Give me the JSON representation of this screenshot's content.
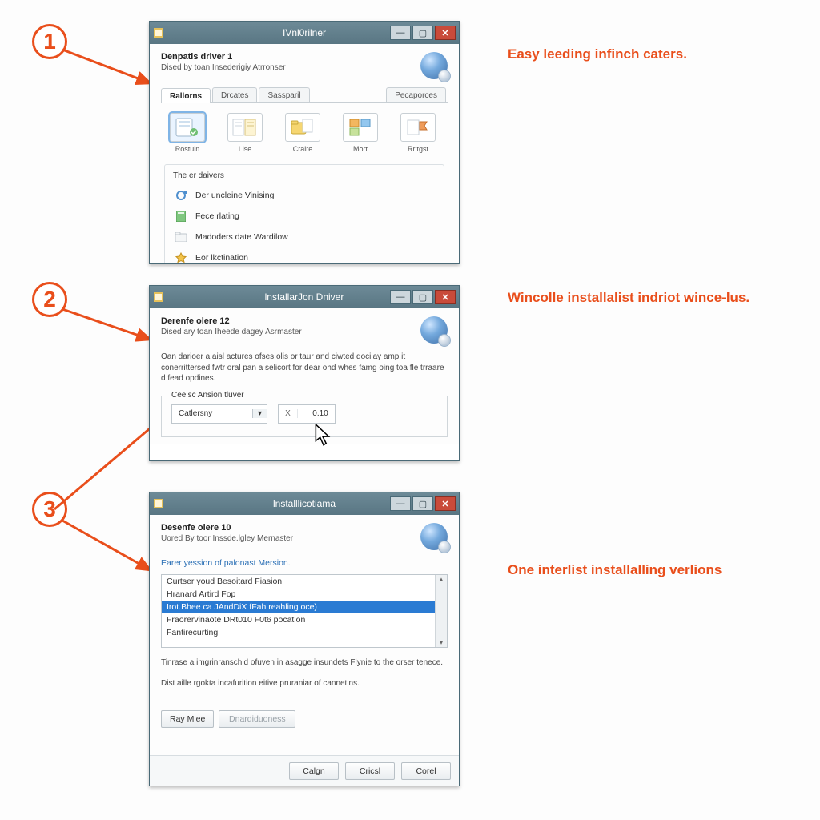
{
  "accent": "#e94e1b",
  "steps": {
    "s1": {
      "num": "1",
      "caption": "Easy leeding infinch caters."
    },
    "s2": {
      "num": "2",
      "caption": "Wincolle installalist indriot wince-lus."
    },
    "s3": {
      "num": "3",
      "caption": "One interlist installalling verlions"
    }
  },
  "win1": {
    "title": "IVnl0rilner",
    "wiz_title": "Denpatis driver 1",
    "wiz_sub": "Dised by toan Insederigiy Atrronser",
    "tabs": {
      "t1": "Rallorns",
      "t2": "Drcates",
      "t3": "Sassparil",
      "right": "Pecaporces"
    },
    "tools": {
      "a": "Rostuin",
      "b": "Lise",
      "c": "Cralre",
      "d": "Mort",
      "e": "Rritgst"
    },
    "group_title": "The er daivers",
    "items": {
      "i1": "Der uncleine Vinising",
      "i2": "Fece rlating",
      "i3": "Madoders date Wardilow",
      "i4": "Eor lkctination"
    }
  },
  "win2": {
    "title": "lnstallarJon Dniver",
    "wiz_title": "Derenfe olere 12",
    "wiz_sub": "Dised ary toan Iheede dagey Asrmaster",
    "body": "Oan darioer a aisl actures ofses olis or taur and ciwted docilay amp it conerrittersed fwtr oral pan a selicort for dear ohd whes famg oing toa fle trraare d fead opdines.",
    "legend": "Ceelsc Ansion tluver",
    "combo_value": "Catlersny",
    "num_label": "X",
    "num_value": "0.10"
  },
  "win3": {
    "title": "lnstalllicotiama",
    "wiz_title": "Desenfe olere 10",
    "wiz_sub": "Uored By toor Inssde.lgley Mernaster",
    "link": "Earer yession of palonast Mersion.",
    "options": {
      "o1": "Curtser youd Besoitard Fiasion",
      "o2": "Hranard Artird Fop",
      "o3": "Irot.Bhee ca JAndDiX fFah reahling oce)",
      "o4": "Fraorervinaote DRt010 F0t6 pocation",
      "o5": "Fantirecurting"
    },
    "note1": "Tinrase a imgrinranschld ofuven in asagge insundets Flynie to the orser tenece.",
    "note2": "Dist aille rgokta incafurition eitive pruraniar of cannetins.",
    "rec1": "Ray Miee",
    "rec2": "Dnardiduoness",
    "btn_ok": "Calgn",
    "btn_cancel": "Cricsl",
    "btn_close": "Corel"
  }
}
